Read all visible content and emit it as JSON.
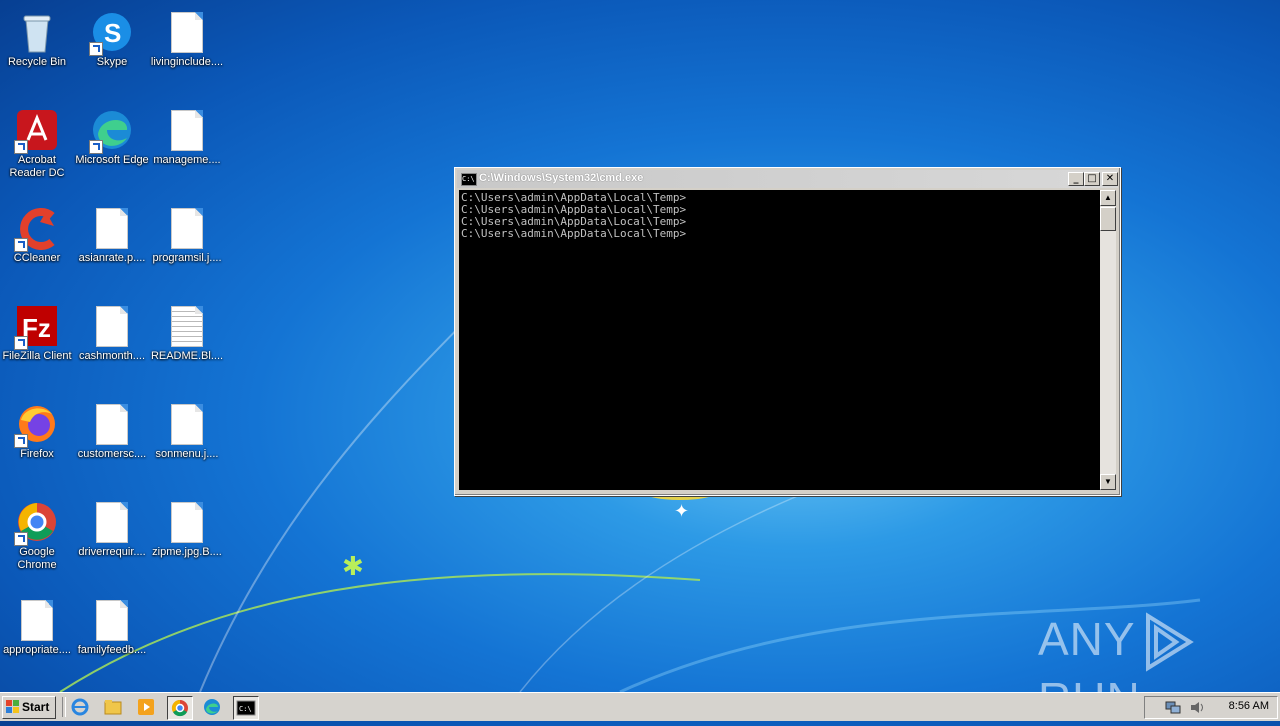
{
  "desktop": {
    "icons": [
      {
        "label": "Recycle Bin",
        "icon": "recycle-bin-icon"
      },
      {
        "label": "Skype",
        "icon": "skype-icon"
      },
      {
        "label": "livinginclude....",
        "icon": "file-icon"
      },
      {
        "label": "Acrobat Reader DC",
        "icon": "acrobat-icon"
      },
      {
        "label": "Microsoft Edge",
        "icon": "edge-icon"
      },
      {
        "label": "manageme....",
        "icon": "file-icon"
      },
      {
        "label": "CCleaner",
        "icon": "ccleaner-icon"
      },
      {
        "label": "asianrate.p....",
        "icon": "file-icon"
      },
      {
        "label": "programsil.j....",
        "icon": "file-icon"
      },
      {
        "label": "FileZilla Client",
        "icon": "filezilla-icon"
      },
      {
        "label": "cashmonth....",
        "icon": "file-icon"
      },
      {
        "label": "README.Bl....",
        "icon": "text-file-icon"
      },
      {
        "label": "Firefox",
        "icon": "firefox-icon"
      },
      {
        "label": "customersc....",
        "icon": "file-icon"
      },
      {
        "label": "sonmenu.j....",
        "icon": "file-icon"
      },
      {
        "label": "Google Chrome",
        "icon": "chrome-icon"
      },
      {
        "label": "driverrequir....",
        "icon": "file-icon"
      },
      {
        "label": "zipme.jpg.B....",
        "icon": "file-icon"
      },
      {
        "label": "appropriate....",
        "icon": "file-icon"
      },
      {
        "label": "familyfeedb....",
        "icon": "file-icon"
      }
    ]
  },
  "cmd_window": {
    "title": "C:\\Windows\\System32\\cmd.exe",
    "icon_text": "C:\\",
    "minimize": "_",
    "maximize": "□",
    "close": "✕",
    "lines": [
      "C:\\Users\\admin\\AppData\\Local\\Temp>",
      "C:\\Users\\admin\\AppData\\Local\\Temp>",
      "C:\\Users\\admin\\AppData\\Local\\Temp>",
      "C:\\Users\\admin\\AppData\\Local\\Temp>"
    ]
  },
  "watermark": {
    "left": "ANY",
    "right": "RUN"
  },
  "taskbar": {
    "start_label": "Start",
    "pinned": [
      "ie-icon",
      "explorer-icon",
      "media-player-icon",
      "chrome-icon",
      "edge-icon",
      "cmd-icon"
    ],
    "clock": "8:56 AM"
  },
  "colors": {
    "accent": "#0b58b8",
    "taskbar": "#d6d3ce"
  }
}
